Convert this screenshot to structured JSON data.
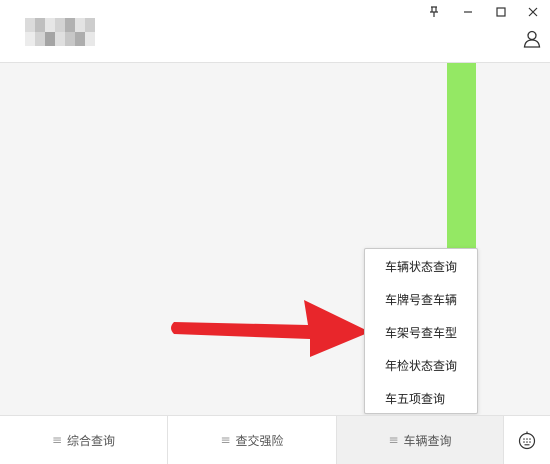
{
  "window_controls": {
    "pin_icon": "pin-icon",
    "minimize_icon": "minimize-icon",
    "maximize_icon": "maximize-icon",
    "close_icon": "close-icon"
  },
  "header": {
    "user_icon": "user-icon"
  },
  "colors": {
    "green_bar": "#94e864",
    "arrow": "#e8262b",
    "background": "#f5f5f5"
  },
  "menu": {
    "items": [
      {
        "label": "车辆状态查询"
      },
      {
        "label": "车牌号查车辆"
      },
      {
        "label": "车架号查车型"
      },
      {
        "label": "年检状态查询"
      },
      {
        "label": "车五项查询"
      }
    ]
  },
  "tabs": [
    {
      "label": "综合查询",
      "menu_glyph": "≡"
    },
    {
      "label": "查交强险",
      "menu_glyph": "≡"
    },
    {
      "label": "车辆查询",
      "menu_glyph": "≡"
    }
  ],
  "bottom": {
    "keyboard_icon": "keyboard-icon"
  }
}
